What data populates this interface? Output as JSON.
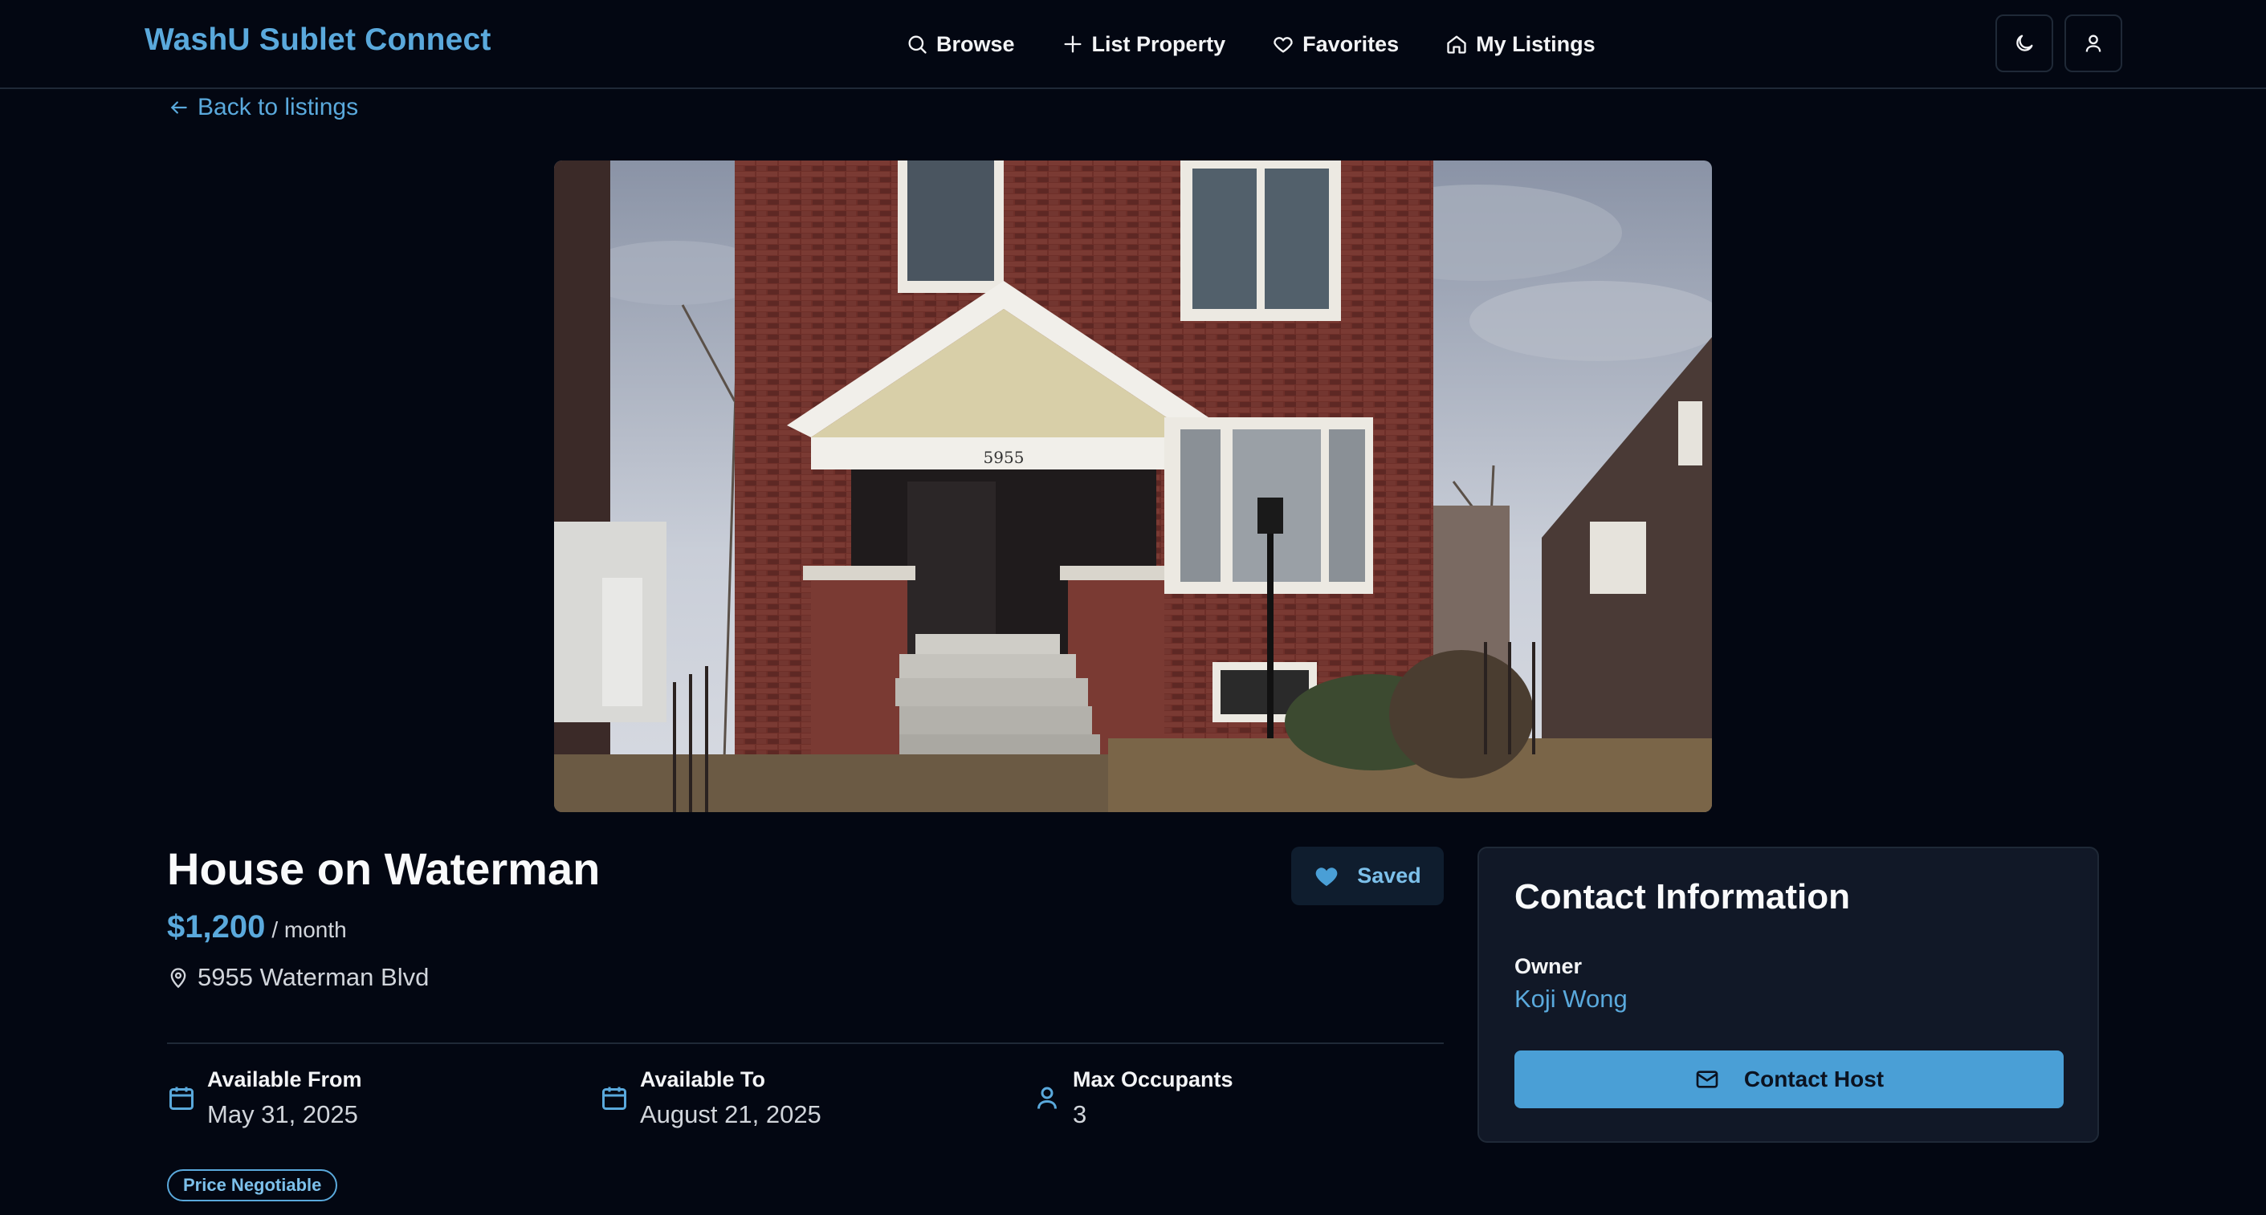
{
  "brand": "WashU Sublet Connect",
  "nav": {
    "browse": "Browse",
    "list_property": "List Property",
    "favorites": "Favorites",
    "my_listings": "My Listings"
  },
  "header_icons": [
    "moon-icon",
    "user-icon"
  ],
  "back_link": "Back to listings",
  "listing": {
    "title": "House on Waterman",
    "price": "$1,200",
    "price_period": "/ month",
    "address": "5955 Waterman Blvd",
    "saved_label": "Saved",
    "house_number_sign": "5955",
    "details": [
      {
        "label": "Available From",
        "value": "May 31, 2025",
        "icon": "calendar-icon"
      },
      {
        "label": "Available To",
        "value": "August 21, 2025",
        "icon": "calendar-icon"
      },
      {
        "label": "Max Occupants",
        "value": "3",
        "icon": "user-icon"
      }
    ],
    "tag": "Price Negotiable"
  },
  "contact": {
    "title": "Contact Information",
    "owner_label": "Owner",
    "owner_name": "Koji Wong",
    "button_label": "Contact Host"
  },
  "colors": {
    "background": "#030712",
    "accent": "#5aa9dc",
    "card": "#111827",
    "button": "#4a9fd6"
  }
}
